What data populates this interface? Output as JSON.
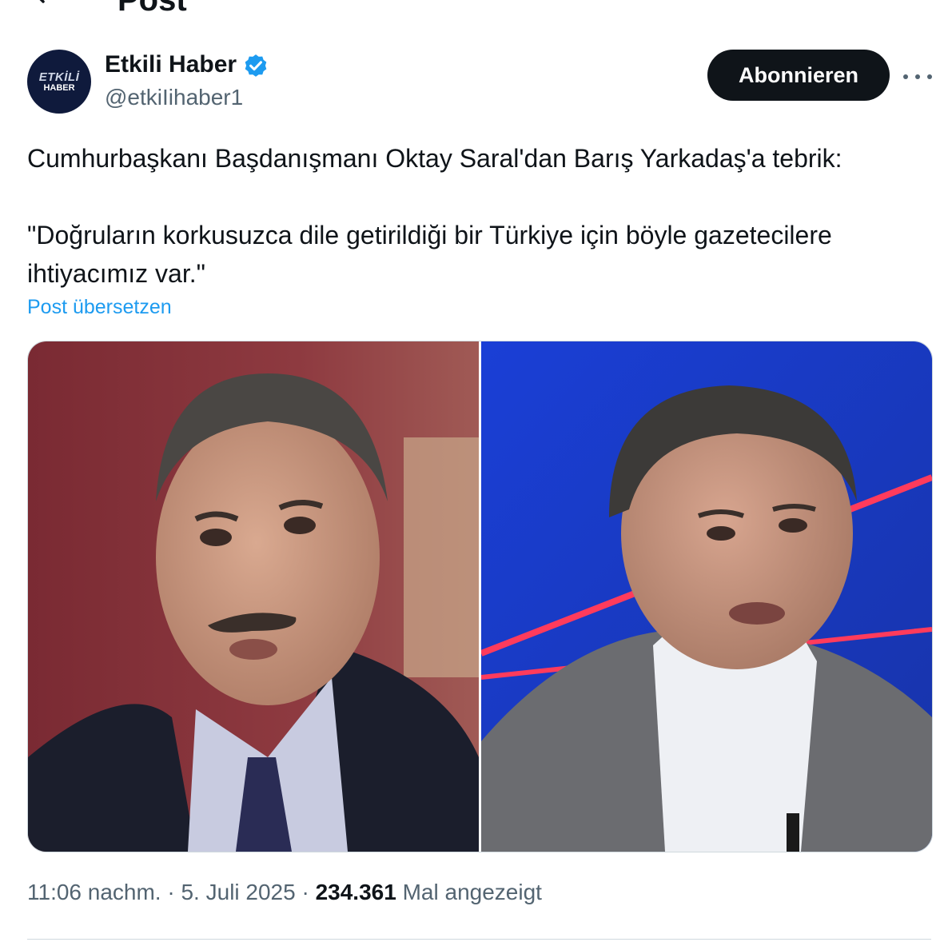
{
  "header": {
    "title": "Post"
  },
  "author": {
    "avatar_line1": "ETKİLİ",
    "avatar_line2": "HABER",
    "display_name": "Etkili Haber",
    "handle": "@etkiIihaber1"
  },
  "actions": {
    "follow_label": "Abonnieren"
  },
  "post": {
    "line1": "Cumhurbaşkanı Başdanışmanı Oktay Saral'dan Barış Yarkadaş'a tebrik:",
    "line2": "\"Doğruların korkusuzca dile getirildiği bir Türkiye için böyle gazetecilere ihtiyacımız var.\"",
    "translate_label": "Post übersetzen"
  },
  "meta": {
    "time": "11:06 nachm.",
    "separator": " · ",
    "date": "5. Juli 2025",
    "views_count": "234.361",
    "views_label": "Mal angezeigt"
  },
  "colors": {
    "accent": "#1d9bf0",
    "button_bg": "#0f1419",
    "muted_text": "#536471",
    "border": "#cfd9de"
  },
  "icons": {
    "back": "arrow-left-icon",
    "verified": "verified-badge-icon",
    "more": "more-horizontal-icon"
  }
}
